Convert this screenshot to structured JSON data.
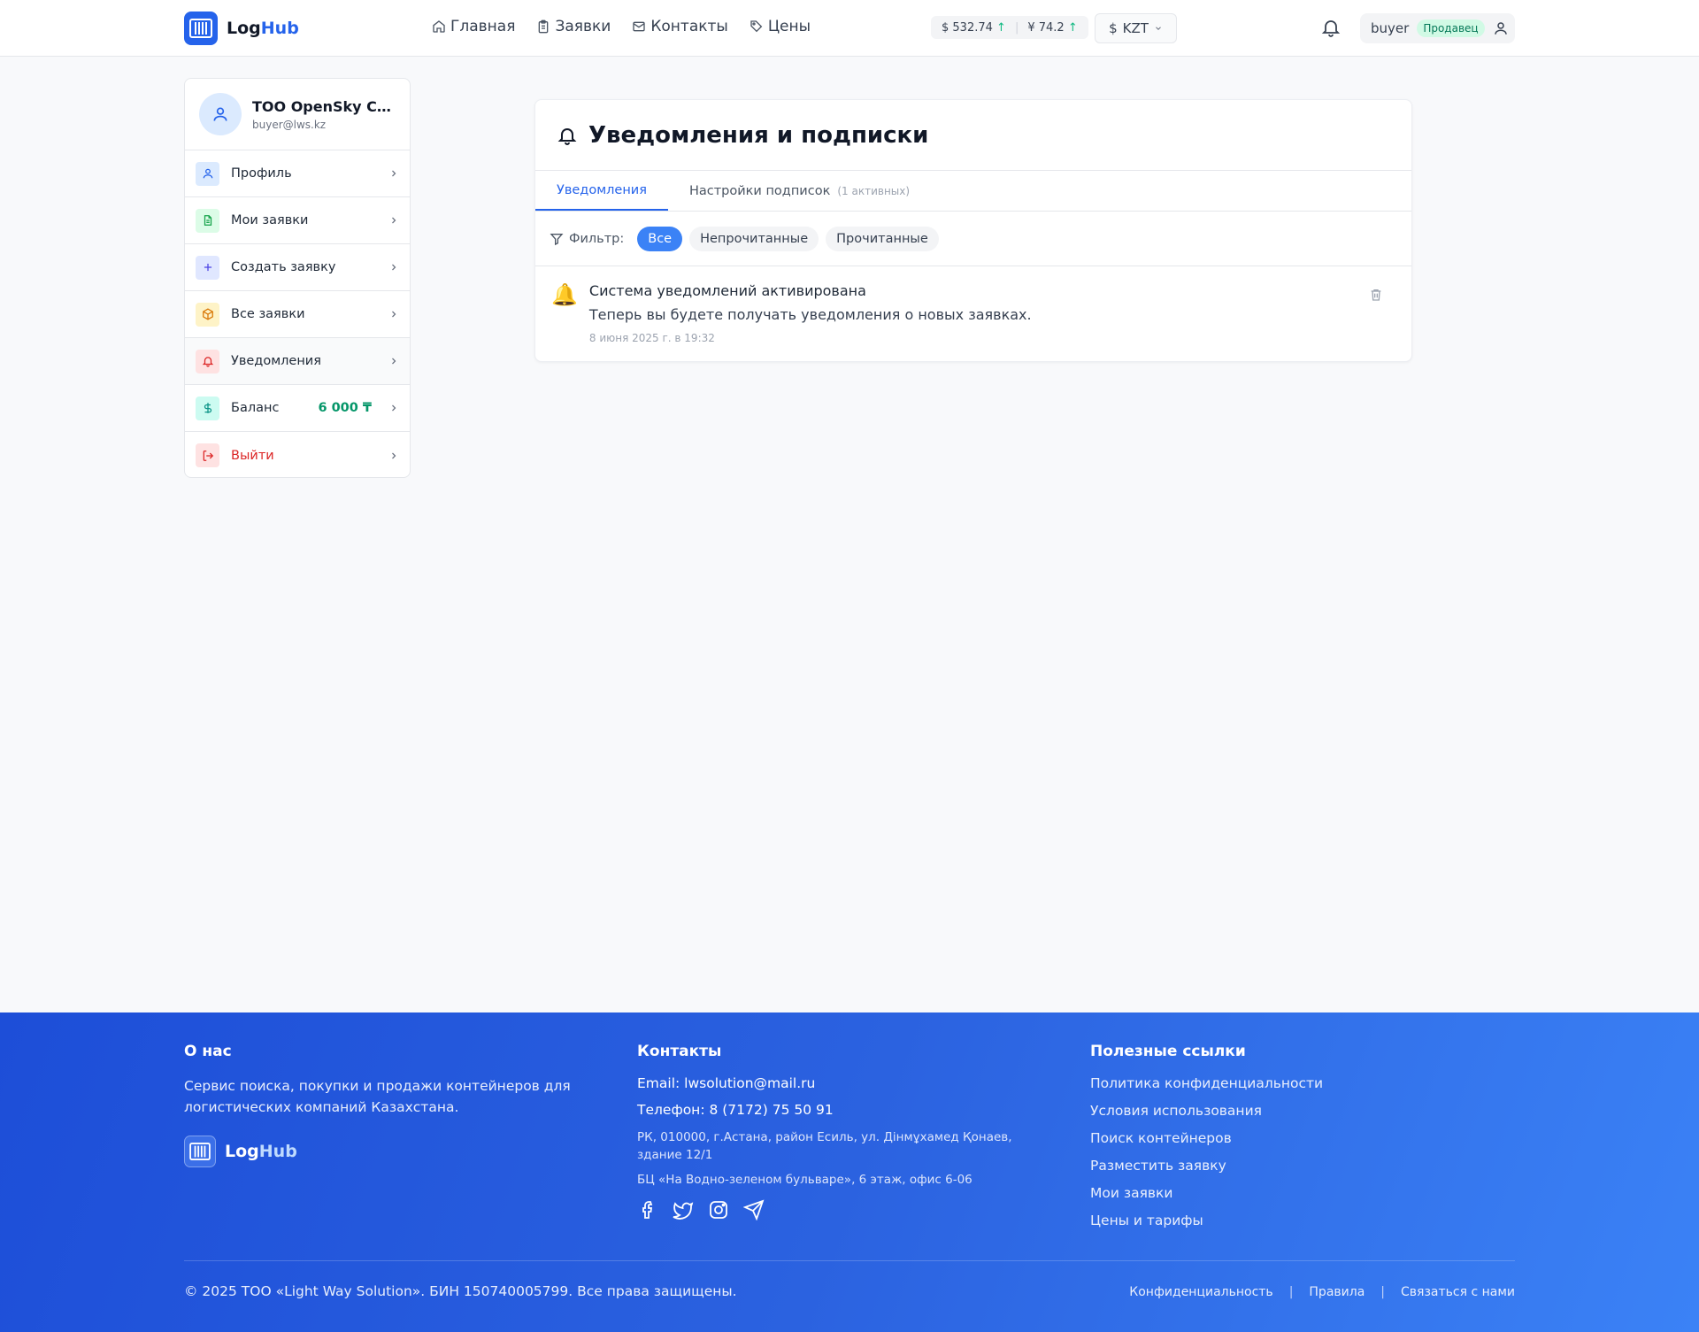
{
  "header": {
    "logo": {
      "part1": "Log",
      "part2": "Hub"
    },
    "nav": [
      {
        "label": "Главная",
        "icon": "home-icon"
      },
      {
        "label": "Заявки",
        "icon": "clipboard-icon"
      },
      {
        "label": "Контакты",
        "icon": "mail-icon"
      },
      {
        "label": "Цены",
        "icon": "tag-icon"
      }
    ],
    "rates": {
      "usd": "$ 532.74",
      "cny": "¥ 74.2",
      "trend": "↑"
    },
    "currency": {
      "symbol": "$",
      "value": "KZT"
    },
    "user": {
      "name": "buyer",
      "role": "Продавец"
    }
  },
  "sidebar": {
    "company": "ТОО OpenSky Container",
    "email": "buyer@lws.kz",
    "items": [
      {
        "label": "Профиль",
        "icon": "user-icon"
      },
      {
        "label": "Мои заявки",
        "icon": "file-text-icon"
      },
      {
        "label": "Создать заявку",
        "icon": "plus-icon"
      },
      {
        "label": "Все заявки",
        "icon": "package-icon"
      },
      {
        "label": "Уведомления",
        "icon": "bell-icon"
      },
      {
        "label": "Баланс",
        "icon": "dollar-icon",
        "value": "6 000 ₸"
      },
      {
        "label": "Выйти",
        "icon": "logout-icon"
      }
    ]
  },
  "main": {
    "title": "Уведомления и подписки",
    "tabs": [
      {
        "label": "Уведомления"
      },
      {
        "label": "Настройки подписок",
        "note": "(1 активных)"
      }
    ],
    "filter": {
      "label": "Фильтр:",
      "options": [
        "Все",
        "Непрочитанные",
        "Прочитанные"
      ],
      "selected": "Все"
    },
    "notifications": [
      {
        "emoji": "🔔",
        "title": "Система уведомлений активирована",
        "message": "Теперь вы будете получать уведомления о новых заявках.",
        "time": "8 июня 2025 г. в 19:32"
      }
    ]
  },
  "footer": {
    "about": {
      "heading": "О нас",
      "text": "Сервис поиска, покупки и продажи контейнеров для логистических компаний Казахстана."
    },
    "contacts": {
      "heading": "Контакты",
      "email": "Email: lwsolution@mail.ru",
      "phone": "Телефон: 8 (7172) 75 50 91",
      "address": "РК, 010000, г.Астана, район Есиль, ул. Дінмұхамед Қонаев, здание 12/1",
      "office": "БЦ «На Водно-зеленом бульваре», 6 этаж, офис 6-06"
    },
    "links": {
      "heading": "Полезные ссылки",
      "items": [
        "Политика конфиденциальности",
        "Условия использования",
        "Поиск контейнеров",
        "Разместить заявку",
        "Мои заявки",
        "Цены и тарифы"
      ]
    },
    "copyright": "© 2025 ТОО «Light Way Solution». БИН 150740005799. Все права защищены.",
    "bottom_links": [
      "Конфиденциальность",
      "Правила",
      "Связаться с нами"
    ],
    "bottom_sep": "|"
  },
  "colors": {
    "primary": "#2563eb",
    "accent": "#3b82f6",
    "success": "#059669",
    "danger": "#dc2626"
  }
}
